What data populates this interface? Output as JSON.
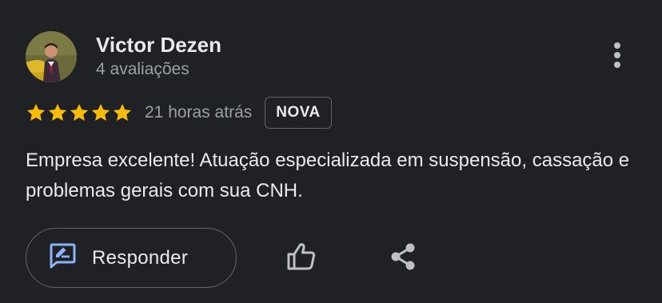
{
  "review": {
    "author_name": "Victor Dezen",
    "author_meta": "4 avaliações",
    "rating": 5,
    "max_rating": 5,
    "time_ago": "21 horas atrás",
    "badge": "NOVA",
    "text": "Empresa excelente! Atuação especializada em suspensão, cassação e problemas gerais com sua CNH."
  },
  "actions": {
    "reply_label": "Responder"
  },
  "icons": {
    "more": "more-vert-icon",
    "reply": "rate-review-icon",
    "like": "thumb-up-icon",
    "share": "share-icon",
    "star": "star-icon"
  },
  "colors": {
    "background": "#202124",
    "star": "#fbbc04",
    "accent": "#8ab4f8",
    "secondary_text": "#9aa0a6",
    "border": "#5f6368"
  }
}
